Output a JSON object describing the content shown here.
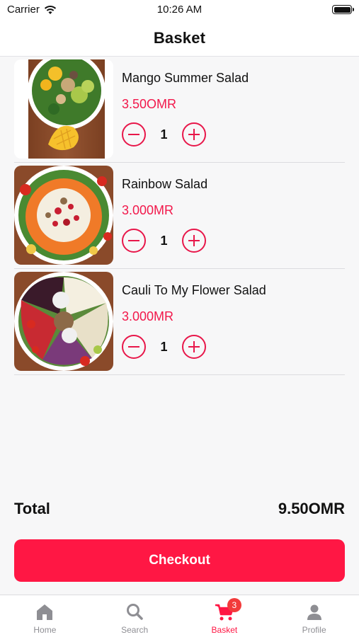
{
  "status_bar": {
    "carrier": "Carrier",
    "time": "10:26 AM"
  },
  "nav": {
    "title": "Basket"
  },
  "items": [
    {
      "name": "Mango Summer Salad",
      "price": "3.50OMR",
      "quantity": "1",
      "image_icon": "mango-salad-photo"
    },
    {
      "name": "Rainbow Salad",
      "price": "3.000MR",
      "quantity": "1",
      "image_icon": "rainbow-salad-photo"
    },
    {
      "name": "Cauli To My Flower Salad",
      "price": "3.000MR",
      "quantity": "1",
      "image_icon": "cauliflower-salad-photo"
    }
  ],
  "total": {
    "label": "Total",
    "value": "9.50OMR"
  },
  "checkout": {
    "label": "Checkout"
  },
  "tabs": [
    {
      "label": "Home",
      "icon": "home-icon"
    },
    {
      "label": "Search",
      "icon": "search-icon"
    },
    {
      "label": "Basket",
      "icon": "cart-icon",
      "badge": "3",
      "active": true
    },
    {
      "label": "Profile",
      "icon": "profile-icon"
    }
  ],
  "colors": {
    "accent": "#ff1744",
    "price": "#f2184b",
    "inactive_tab": "#8e8e93"
  }
}
